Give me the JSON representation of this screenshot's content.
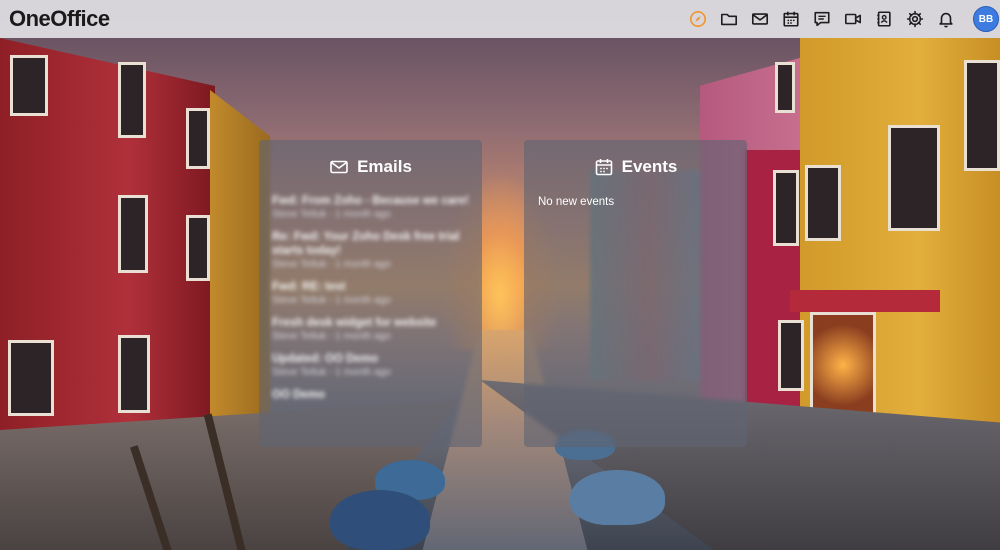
{
  "app": {
    "name": "OneOffice"
  },
  "topbar": {
    "icons": [
      {
        "name": "compass-icon",
        "active": true
      },
      {
        "name": "folder-icon"
      },
      {
        "name": "mail-icon"
      },
      {
        "name": "calendar-icon"
      },
      {
        "name": "chat-icon"
      },
      {
        "name": "video-icon"
      },
      {
        "name": "contacts-icon"
      },
      {
        "name": "settings-icon"
      },
      {
        "name": "bell-icon"
      }
    ],
    "accent_color": "#f0962a",
    "avatar_initials": "BB"
  },
  "emails_widget": {
    "title": "Emails",
    "items": [
      {
        "subject": "Fwd: From Zoho - Because we care!",
        "meta": "Steve Tetluk - 1 month ago"
      },
      {
        "subject": "Re: Fwd: Your Zoho Desk free trial starts today!",
        "meta": "Steve Tetluk - 1 month ago"
      },
      {
        "subject": "Fwd: RE: test",
        "meta": "Steve Tetluk - 1 month ago"
      },
      {
        "subject": "Fresh desk widget for website",
        "meta": "Steve Tetluk - 1 month ago"
      },
      {
        "subject": "Updated: OO Demo",
        "meta": "Steve Tetluk - 1 month ago"
      },
      {
        "subject": "OO Demo",
        "meta": ""
      }
    ]
  },
  "events_widget": {
    "title": "Events",
    "empty_text": "No new events"
  }
}
